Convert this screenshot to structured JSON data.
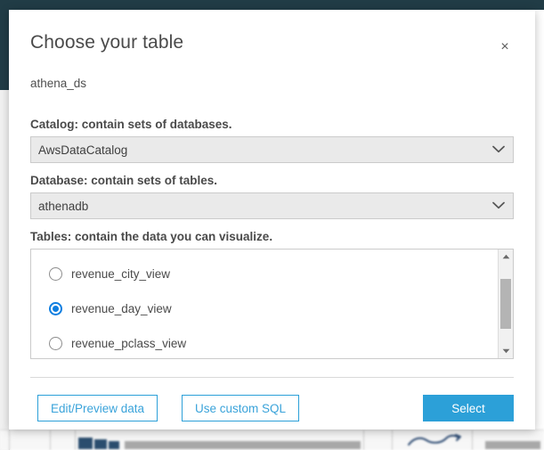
{
  "background": {
    "topbar_color": "#213c46",
    "accent_blue": "#2ca0d8",
    "radio_blue": "#0f7ee0"
  },
  "modal": {
    "title": "Choose your table",
    "subtitle": "athena_ds",
    "close_label": "×",
    "catalog": {
      "label": "Catalog: contain sets of databases.",
      "value": "AwsDataCatalog"
    },
    "database": {
      "label": "Database: contain sets of tables.",
      "value": "athenadb"
    },
    "tables": {
      "label": "Tables: contain the data you can visualize.",
      "selected": "revenue_day_view",
      "options": [
        {
          "label": "revenue_city_view",
          "checked": false
        },
        {
          "label": "revenue_day_view",
          "checked": true
        },
        {
          "label": "revenue_pclass_view",
          "checked": false
        }
      ]
    },
    "footer": {
      "edit_preview_label": "Edit/Preview data",
      "custom_sql_label": "Use custom SQL",
      "select_label": "Select"
    }
  }
}
